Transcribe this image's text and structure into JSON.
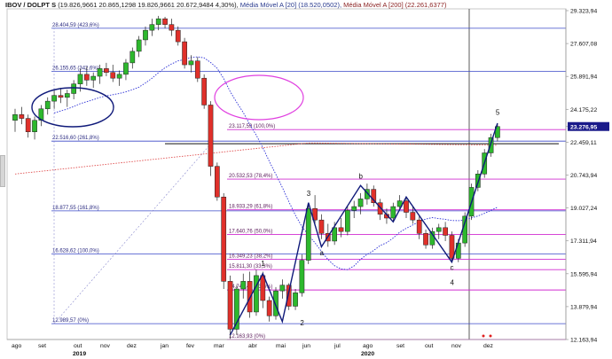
{
  "header": {
    "symbol": "IBOV / DOLPT S",
    "ohlc": "(19.826,9661  20.865,1298  19.826,9661  20.672,9484  4,30%),",
    "ma1": "Média Móvel A [20] (18.520,0502),",
    "ma2": "Média Móvel A [200] (22.261,6377)"
  },
  "colors": {
    "up": "#2db82d",
    "down": "#e0302a",
    "grid_blue": "#3a48c8",
    "fib_magenta": "#d12bd1",
    "ma20": "#2b2fd6",
    "ma200": "#e05050",
    "wave": "#101a7a",
    "ellipse_blue": "#101a7a",
    "ellipse_magenta": "#e040e0"
  },
  "chart_data": {
    "type": "candlestick",
    "y_axis_labels": [
      "29.323,94",
      "27.607,08",
      "25.891,94",
      "24.175,22",
      "23.276,95",
      "22.459,11",
      "20.743,94",
      "19.027,24",
      "17.311,94",
      "15.595,94",
      "13.879,94",
      "12.163,94"
    ],
    "y_range": [
      12163.94,
      29323.94
    ],
    "x_month_labels": [
      "ago",
      "set",
      "out",
      "nov",
      "dez",
      "jan",
      "fev",
      "mar",
      "abr",
      "mai",
      "jun",
      "jul",
      "ago",
      "set",
      "out",
      "nov",
      "dez"
    ],
    "x_year_labels": [
      "2019",
      "2020"
    ],
    "last_price_label": "23.276,95",
    "fib_blue": [
      {
        "label": "28.404,59 (423,6%)",
        "value": 28404.59
      },
      {
        "label": "26.155,65 (342,6%)",
        "value": 26155.65
      },
      {
        "label": "22.516,60 (261,8%)",
        "value": 22516.6
      },
      {
        "label": "18.877,55 (161,8%)",
        "value": 18877.55
      },
      {
        "label": "16.628,62 (100,0%)",
        "value": 16628.62
      },
      {
        "label": "12.989,57 (0%)",
        "value": 12989.57
      }
    ],
    "fib_magenta": [
      {
        "label": "23.117,59 (100,0%)",
        "value": 23117.59
      },
      {
        "label": "20.532,53 (78,4%)",
        "value": 20532.53
      },
      {
        "label": "18.933,29 (61,8%)",
        "value": 18933.29
      },
      {
        "label": "17.640,76 (50,0%)",
        "value": 17640.76
      },
      {
        "label": "16.349,23 (38,2%)",
        "value": 16349.23
      },
      {
        "label": "15.811,30 (33,3%)",
        "value": 15811.3
      },
      {
        "label": "14.748,47 (23,6%)",
        "value": 14748.47
      },
      {
        "label": "12.163,93 (0%)",
        "value": 12163.93
      }
    ],
    "wave_labels": [
      "1",
      "2",
      "3",
      "a",
      "b",
      "c",
      "4",
      "5"
    ],
    "candles": [
      {
        "o": 23600,
        "h": 24200,
        "l": 23000,
        "c": 23900
      },
      {
        "o": 23900,
        "h": 24300,
        "l": 23400,
        "c": 23700
      },
      {
        "o": 23700,
        "h": 23900,
        "l": 22700,
        "c": 23000
      },
      {
        "o": 23000,
        "h": 23800,
        "l": 22600,
        "c": 23600
      },
      {
        "o": 23600,
        "h": 24400,
        "l": 23300,
        "c": 24200
      },
      {
        "o": 24200,
        "h": 24800,
        "l": 23900,
        "c": 24600
      },
      {
        "o": 24600,
        "h": 25200,
        "l": 24200,
        "c": 24900
      },
      {
        "o": 24900,
        "h": 25300,
        "l": 24500,
        "c": 24800
      },
      {
        "o": 24800,
        "h": 25200,
        "l": 24300,
        "c": 25000
      },
      {
        "o": 25000,
        "h": 25700,
        "l": 24700,
        "c": 25500
      },
      {
        "o": 25500,
        "h": 26300,
        "l": 25100,
        "c": 26000
      },
      {
        "o": 26000,
        "h": 26400,
        "l": 25400,
        "c": 25700
      },
      {
        "o": 25700,
        "h": 26100,
        "l": 25300,
        "c": 25900
      },
      {
        "o": 25900,
        "h": 26500,
        "l": 25500,
        "c": 26300
      },
      {
        "o": 26300,
        "h": 26600,
        "l": 25900,
        "c": 26100
      },
      {
        "o": 26100,
        "h": 26500,
        "l": 25600,
        "c": 25800
      },
      {
        "o": 25800,
        "h": 26200,
        "l": 25400,
        "c": 26000
      },
      {
        "o": 26000,
        "h": 26800,
        "l": 25700,
        "c": 26600
      },
      {
        "o": 26600,
        "h": 27400,
        "l": 26300,
        "c": 27200
      },
      {
        "o": 27200,
        "h": 28000,
        "l": 26900,
        "c": 27800
      },
      {
        "o": 27800,
        "h": 28500,
        "l": 27500,
        "c": 28300
      },
      {
        "o": 28300,
        "h": 28900,
        "l": 28000,
        "c": 28600
      },
      {
        "o": 28600,
        "h": 29050,
        "l": 28300,
        "c": 28900
      },
      {
        "o": 28900,
        "h": 29000,
        "l": 28400,
        "c": 28600
      },
      {
        "o": 28600,
        "h": 28900,
        "l": 28000,
        "c": 28300
      },
      {
        "o": 28300,
        "h": 28500,
        "l": 27500,
        "c": 27700
      },
      {
        "o": 27700,
        "h": 27900,
        "l": 26300,
        "c": 26500
      },
      {
        "o": 26500,
        "h": 27000,
        "l": 26100,
        "c": 26700
      },
      {
        "o": 26700,
        "h": 26900,
        "l": 25600,
        "c": 25800
      },
      {
        "o": 25800,
        "h": 26000,
        "l": 24200,
        "c": 24400
      },
      {
        "o": 24400,
        "h": 24600,
        "l": 20700,
        "c": 21200
      },
      {
        "o": 21200,
        "h": 21400,
        "l": 19400,
        "c": 19600
      },
      {
        "o": 19600,
        "h": 19800,
        "l": 14800,
        "c": 15200
      },
      {
        "o": 15200,
        "h": 15500,
        "l": 12200,
        "c": 12700
      },
      {
        "o": 12700,
        "h": 15000,
        "l": 12400,
        "c": 14800
      },
      {
        "o": 14800,
        "h": 15600,
        "l": 14300,
        "c": 15200
      },
      {
        "o": 15200,
        "h": 15700,
        "l": 13300,
        "c": 13600
      },
      {
        "o": 13600,
        "h": 15800,
        "l": 13400,
        "c": 15500
      },
      {
        "o": 15500,
        "h": 15700,
        "l": 13800,
        "c": 14200
      },
      {
        "o": 14200,
        "h": 14400,
        "l": 13100,
        "c": 13400
      },
      {
        "o": 13400,
        "h": 14900,
        "l": 13200,
        "c": 14700
      },
      {
        "o": 14700,
        "h": 15300,
        "l": 14300,
        "c": 15000
      },
      {
        "o": 15000,
        "h": 15100,
        "l": 13700,
        "c": 13900
      },
      {
        "o": 13900,
        "h": 14800,
        "l": 13700,
        "c": 14600
      },
      {
        "o": 14600,
        "h": 16600,
        "l": 14400,
        "c": 16300
      },
      {
        "o": 16300,
        "h": 19300,
        "l": 16100,
        "c": 19000
      },
      {
        "o": 19000,
        "h": 19700,
        "l": 18100,
        "c": 18400
      },
      {
        "o": 18400,
        "h": 18700,
        "l": 17400,
        "c": 17700
      },
      {
        "o": 17700,
        "h": 18200,
        "l": 17000,
        "c": 17300
      },
      {
        "o": 17300,
        "h": 18300,
        "l": 17100,
        "c": 18000
      },
      {
        "o": 18000,
        "h": 18500,
        "l": 17500,
        "c": 17800
      },
      {
        "o": 17800,
        "h": 19100,
        "l": 17600,
        "c": 18900
      },
      {
        "o": 18900,
        "h": 19400,
        "l": 18500,
        "c": 19100
      },
      {
        "o": 19100,
        "h": 19800,
        "l": 18700,
        "c": 19500
      },
      {
        "o": 19500,
        "h": 20300,
        "l": 19200,
        "c": 20000
      },
      {
        "o": 20000,
        "h": 20200,
        "l": 19100,
        "c": 19300
      },
      {
        "o": 19300,
        "h": 19500,
        "l": 18400,
        "c": 18700
      },
      {
        "o": 18700,
        "h": 19000,
        "l": 18200,
        "c": 18500
      },
      {
        "o": 18500,
        "h": 19300,
        "l": 18300,
        "c": 19100
      },
      {
        "o": 19100,
        "h": 19700,
        "l": 18900,
        "c": 19400
      },
      {
        "o": 19400,
        "h": 19600,
        "l": 18500,
        "c": 18800
      },
      {
        "o": 18800,
        "h": 19100,
        "l": 18200,
        "c": 18400
      },
      {
        "o": 18400,
        "h": 18600,
        "l": 17400,
        "c": 17700
      },
      {
        "o": 17700,
        "h": 17900,
        "l": 16900,
        "c": 17100
      },
      {
        "o": 17100,
        "h": 18000,
        "l": 16900,
        "c": 17800
      },
      {
        "o": 17800,
        "h": 18200,
        "l": 17400,
        "c": 18000
      },
      {
        "o": 18000,
        "h": 18300,
        "l": 17300,
        "c": 17600
      },
      {
        "o": 17600,
        "h": 17800,
        "l": 16200,
        "c": 16400
      },
      {
        "o": 16400,
        "h": 17400,
        "l": 16200,
        "c": 17200
      },
      {
        "o": 17200,
        "h": 18800,
        "l": 17000,
        "c": 18600
      },
      {
        "o": 18600,
        "h": 20300,
        "l": 18400,
        "c": 20100
      },
      {
        "o": 20100,
        "h": 21000,
        "l": 19900,
        "c": 20800
      },
      {
        "o": 20800,
        "h": 22100,
        "l": 20600,
        "c": 21900
      },
      {
        "o": 21900,
        "h": 22900,
        "l": 21700,
        "c": 22700
      },
      {
        "o": 22700,
        "h": 23450,
        "l": 22500,
        "c": 23277
      }
    ]
  }
}
